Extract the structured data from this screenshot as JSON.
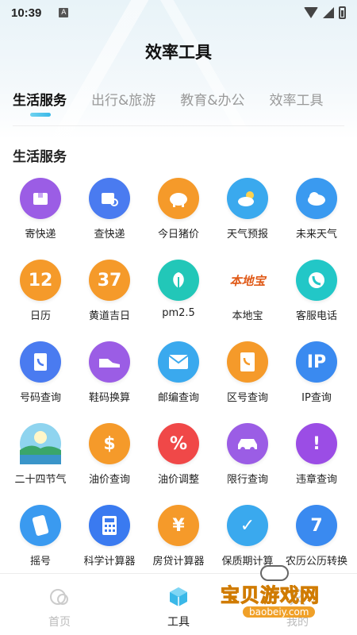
{
  "status_bar": {
    "time": "10:39",
    "notif_letter": "A"
  },
  "page_title": "效率工具",
  "tabs": [
    {
      "label": "生活服务",
      "active": true
    },
    {
      "label": "出行&旅游",
      "active": false
    },
    {
      "label": "教育&办公",
      "active": false
    },
    {
      "label": "效率工具",
      "active": false
    }
  ],
  "section_title": "生活服务",
  "items": [
    {
      "label": "寄快递",
      "icon": "parcel-send-icon",
      "color": "#9b5de5"
    },
    {
      "label": "查快递",
      "icon": "parcel-search-icon",
      "color": "#4a7bf0"
    },
    {
      "label": "今日猪价",
      "icon": "pig-icon",
      "color": "#f59a2a"
    },
    {
      "label": "天气预报",
      "icon": "weather-sun-cloud-icon",
      "color": "#3aa9ee"
    },
    {
      "label": "未来天气",
      "icon": "cloud-icon",
      "color": "#3a9af0"
    },
    {
      "label": "日历",
      "icon": "calendar-icon",
      "color": "#f59a2a",
      "text": "12"
    },
    {
      "label": "黄道吉日",
      "icon": "lucky-day-calendar-icon",
      "color": "#f59a2a",
      "text": "37"
    },
    {
      "label": "pm2.5",
      "icon": "leaf-icon",
      "color": "#22c7b8"
    },
    {
      "label": "本地宝",
      "icon": "bendibao-logo",
      "color": "#e05a18",
      "text": "本地宝"
    },
    {
      "label": "客服电话",
      "icon": "phone-icon",
      "color": "#22c7c7"
    },
    {
      "label": "号码查询",
      "icon": "phonebook-icon",
      "color": "#4a7bf0"
    },
    {
      "label": "鞋码换算",
      "icon": "shoe-icon",
      "color": "#9b5de5"
    },
    {
      "label": "邮编查询",
      "icon": "envelope-icon",
      "color": "#3aa9ee"
    },
    {
      "label": "区号查询",
      "icon": "phone-card-icon",
      "color": "#f59a2a"
    },
    {
      "label": "IP查询",
      "icon": "ip-location-icon",
      "color": "#3a8af0",
      "text": "IP"
    },
    {
      "label": "二十四节气",
      "icon": "landscape-icon",
      "color": "#6ec6e8"
    },
    {
      "label": "油价查询",
      "icon": "dollar-coin-icon",
      "color": "#f59a2a",
      "text": "$"
    },
    {
      "label": "油价调整",
      "icon": "percent-tag-icon",
      "color": "#f04848",
      "text": "%"
    },
    {
      "label": "限行查询",
      "icon": "car-icon",
      "color": "#9b5de5"
    },
    {
      "label": "违章查询",
      "icon": "warning-icon",
      "color": "#9b4de5",
      "text": "!"
    },
    {
      "label": "摇号",
      "icon": "phone-shake-icon",
      "color": "#3a9af0"
    },
    {
      "label": "科学计算器",
      "icon": "calculator-icon",
      "color": "#3a7af0"
    },
    {
      "label": "房贷计算器",
      "icon": "house-loan-icon",
      "color": "#f59a2a",
      "text": "¥"
    },
    {
      "label": "保质期计算",
      "icon": "shield-check-icon",
      "color": "#3aa9ee",
      "text": "✓"
    },
    {
      "label": "农历公历转换",
      "icon": "calendar-convert-icon",
      "color": "#3a8af0",
      "text": "7"
    }
  ],
  "bottom_nav": [
    {
      "label": "首页",
      "icon": "home-circles-icon",
      "active": false
    },
    {
      "label": "工具",
      "icon": "cube-icon",
      "active": true
    },
    {
      "label": "我的",
      "icon": "profile-icon",
      "active": false
    }
  ],
  "watermark": {
    "text": "宝贝游戏网",
    "url": "baobeiy.com"
  }
}
